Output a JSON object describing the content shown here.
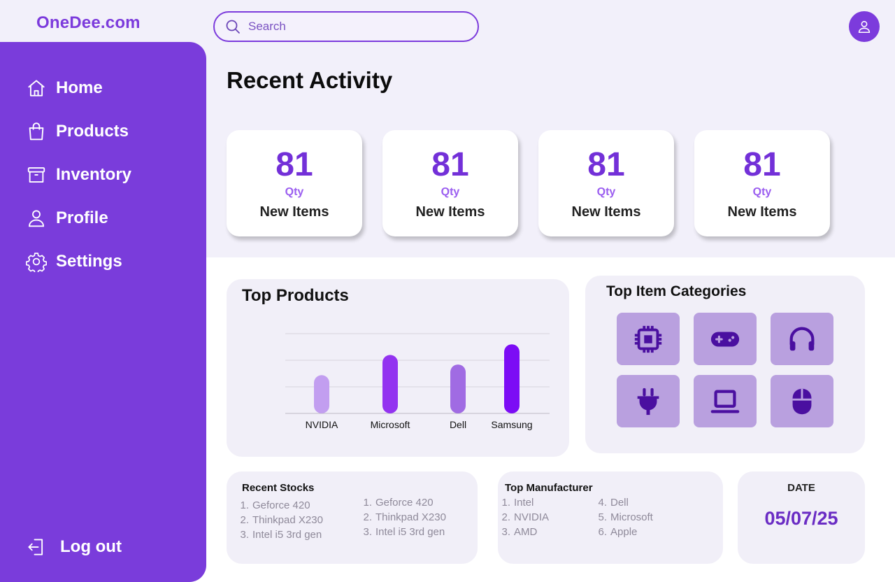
{
  "brand": {
    "name": "OneDee.com",
    "accent": "#7a3cdb"
  },
  "search": {
    "placeholder": "Search"
  },
  "sidebar": {
    "items": [
      {
        "label": "Home",
        "icon": "home-icon"
      },
      {
        "label": "Products",
        "icon": "shopping-bag-icon"
      },
      {
        "label": "Inventory",
        "icon": "archive-box-icon"
      },
      {
        "label": "Profile",
        "icon": "user-icon"
      },
      {
        "label": "Settings",
        "icon": "gear-icon"
      }
    ],
    "logout": {
      "label": "Log out",
      "icon": "logout-icon"
    }
  },
  "page": {
    "title": "Recent Activity"
  },
  "stats": [
    {
      "value": "81",
      "unit": "Qty",
      "label": "New Items"
    },
    {
      "value": "81",
      "unit": "Qty",
      "label": "New Items"
    },
    {
      "value": "81",
      "unit": "Qty",
      "label": "New Items"
    },
    {
      "value": "81",
      "unit": "Qty",
      "label": "New Items"
    }
  ],
  "top_products": {
    "title": "Top Products"
  },
  "chart_data": {
    "type": "bar",
    "categories": [
      "NVIDIA",
      "Microsoft",
      "Dell",
      "Samsung"
    ],
    "values": [
      36,
      55,
      46,
      65
    ],
    "ylim": [
      0,
      75
    ],
    "grid": true,
    "bar_colors": [
      "#c29ef0",
      "#9333f0",
      "#a06be3",
      "#7c0cf5"
    ],
    "title": "",
    "xlabel": "",
    "ylabel": ""
  },
  "top_categories": {
    "title": "Top Item Categories",
    "items": [
      {
        "icon": "cpu-chip-icon"
      },
      {
        "icon": "gamepad-icon"
      },
      {
        "icon": "headphones-icon"
      },
      {
        "icon": "power-plug-icon"
      },
      {
        "icon": "laptop-icon"
      },
      {
        "icon": "mouse-icon"
      }
    ]
  },
  "recent_stocks": {
    "title": "Recent Stocks",
    "column1": [
      {
        "num": "1.",
        "text": "Geforce 420"
      },
      {
        "num": "2.",
        "text": "Thinkpad X230"
      },
      {
        "num": "3.",
        "text": "Intel i5 3rd gen"
      }
    ],
    "column2": [
      {
        "num": "1.",
        "text": "Geforce 420"
      },
      {
        "num": "2.",
        "text": "Thinkpad X230"
      },
      {
        "num": "3.",
        "text": "Intel i5 3rd gen"
      }
    ]
  },
  "top_manufacturer": {
    "title": "Top Manufacturer",
    "column1": [
      {
        "num": "1.",
        "text": "Intel"
      },
      {
        "num": "2.",
        "text": "NVIDIA"
      },
      {
        "num": "3.",
        "text": "AMD"
      }
    ],
    "column2": [
      {
        "num": "4.",
        "text": "Dell"
      },
      {
        "num": "5.",
        "text": "Microsoft"
      },
      {
        "num": "6.",
        "text": "Apple"
      }
    ]
  },
  "date": {
    "label": "DATE",
    "value": "05/07/25"
  }
}
